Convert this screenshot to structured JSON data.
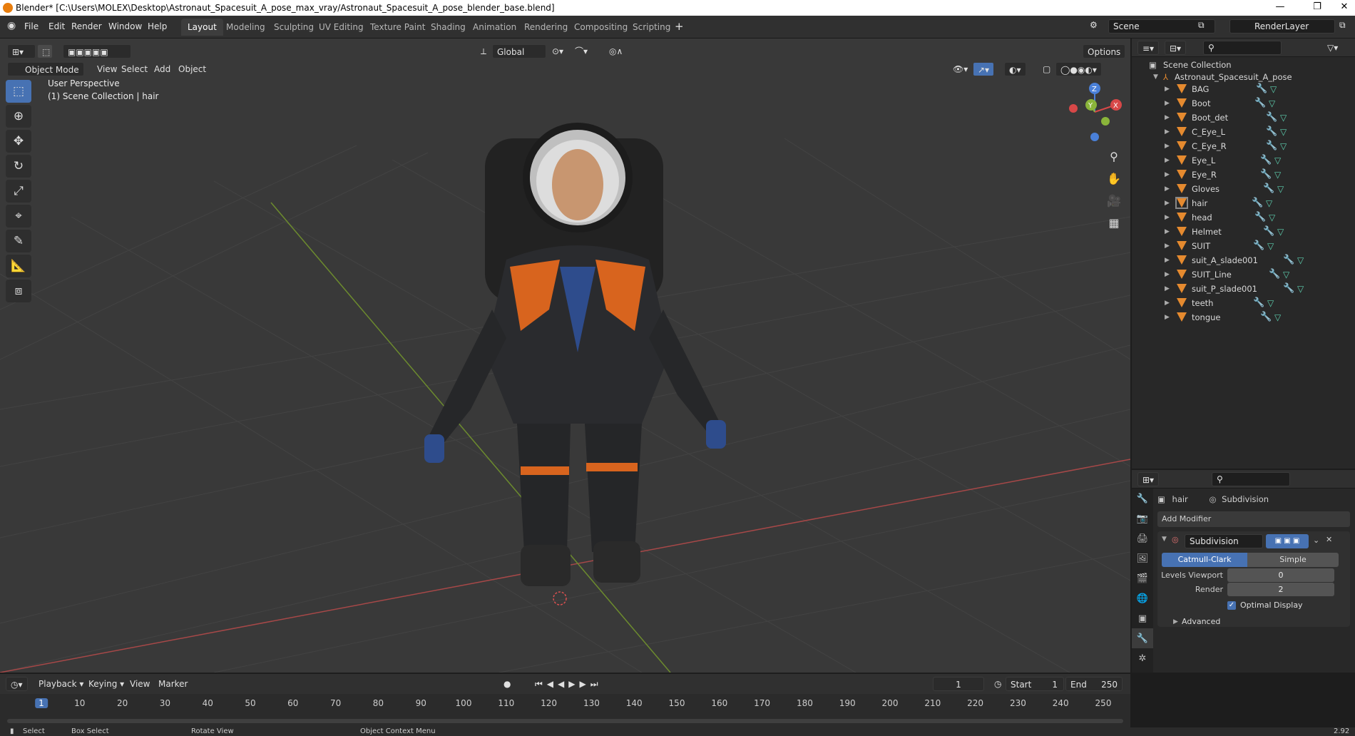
{
  "titlebar": {
    "title": "Blender* [C:\\Users\\MOLEX\\Desktop\\Astronaut_Spacesuit_A_pose_max_vray/Astronaut_Spacesuit_A_pose_blender_base.blend]"
  },
  "menu": {
    "file": "File",
    "edit": "Edit",
    "render": "Render",
    "window": "Window",
    "help": "Help"
  },
  "workspaces": [
    "Layout",
    "Modeling",
    "Sculpting",
    "UV Editing",
    "Texture Paint",
    "Shading",
    "Animation",
    "Rendering",
    "Compositing",
    "Scripting"
  ],
  "active_workspace": "Layout",
  "scene": {
    "name": "Scene",
    "view_layer": "RenderLayer"
  },
  "viewport": {
    "mode": "Object Mode",
    "menus": [
      "View",
      "Select",
      "Add",
      "Object"
    ],
    "orientation": "Global",
    "options": "Options",
    "perspective": "User Perspective",
    "collection_info": "(1) Scene Collection | hair",
    "gizmo": {
      "x": "X",
      "y": "Y",
      "z": "Z"
    }
  },
  "outliner": {
    "root": "Scene Collection",
    "collection": "Astronaut_Spacesuit_A_pose",
    "items": [
      "BAG",
      "Boot",
      "Boot_det",
      "C_Eye_L",
      "C_Eye_R",
      "Eye_L",
      "Eye_R",
      "Gloves",
      "hair",
      "head",
      "Helmet",
      "SUIT",
      "suit_A_slade001",
      "SUIT_Line",
      "suit_P_slade001",
      "teeth",
      "tongue"
    ],
    "selected": "hair"
  },
  "properties": {
    "object": "hair",
    "modifier_crumb": "Subdivision",
    "add_modifier": "Add Modifier",
    "modifier_name": "Subdivision",
    "type_active": "Catmull-Clark",
    "type_other": "Simple",
    "levels_viewport_label": "Levels Viewport",
    "levels_viewport": "0",
    "render_label": "Render",
    "render_value": "2",
    "optimal_display": "Optimal Display",
    "advanced": "Advanced"
  },
  "timeline": {
    "menus": [
      "Playback",
      "Keying",
      "View",
      "Marker"
    ],
    "current_frame": "1",
    "start_label": "Start",
    "start": "1",
    "end_label": "End",
    "end": "250",
    "ticks": [
      "1",
      "10",
      "20",
      "30",
      "40",
      "50",
      "60",
      "70",
      "80",
      "90",
      "100",
      "110",
      "120",
      "130",
      "140",
      "150",
      "160",
      "170",
      "180",
      "190",
      "200",
      "210",
      "220",
      "230",
      "240",
      "250"
    ]
  },
  "statusbar": {
    "select": "Select",
    "box_select": "Box Select",
    "rotate_view": "Rotate View",
    "context_menu": "Object Context Menu",
    "version": "2.92"
  },
  "colors": {
    "accent": "#4772b3",
    "header": "#303030",
    "viewport_bg": "#393939",
    "object_orange": "#e58a2f"
  }
}
